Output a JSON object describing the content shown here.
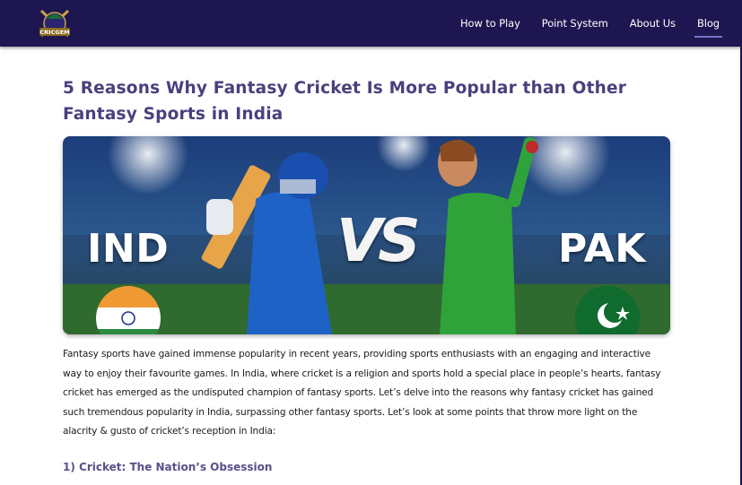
{
  "brand": {
    "logo_text": "CRICGEM"
  },
  "nav": {
    "items": [
      {
        "label": "How to Play"
      },
      {
        "label": "Point System"
      },
      {
        "label": "About Us"
      },
      {
        "label": "Blog"
      }
    ],
    "active": "Blog"
  },
  "article": {
    "title": "5 Reasons Why Fantasy Cricket Is More Popular than Other Fantasy Sports in India",
    "hero": {
      "left_team": "IND",
      "vs": "VS",
      "right_team": "PAK"
    },
    "intro": "Fantasy sports have gained immense popularity in recent years, providing sports enthusiasts with an engaging and interactive way to enjoy their favourite games. In India, where cricket is a religion and sports hold a special place in people’s hearts, fantasy cricket has emerged as the undisputed champion of fantasy sports. Let’s delve into the reasons why fantasy cricket has gained such tremendous popularity in India, surpassing other fantasy sports. Let’s look at some points that throw more light on the alacrity & gusto of  cricket’s reception in India:",
    "section_1_heading": "1) Cricket: The Nation’s Obsession"
  },
  "colors": {
    "nav_bg": "#1e1650",
    "title": "#4b3f7e",
    "accent": "#7b73c8"
  }
}
